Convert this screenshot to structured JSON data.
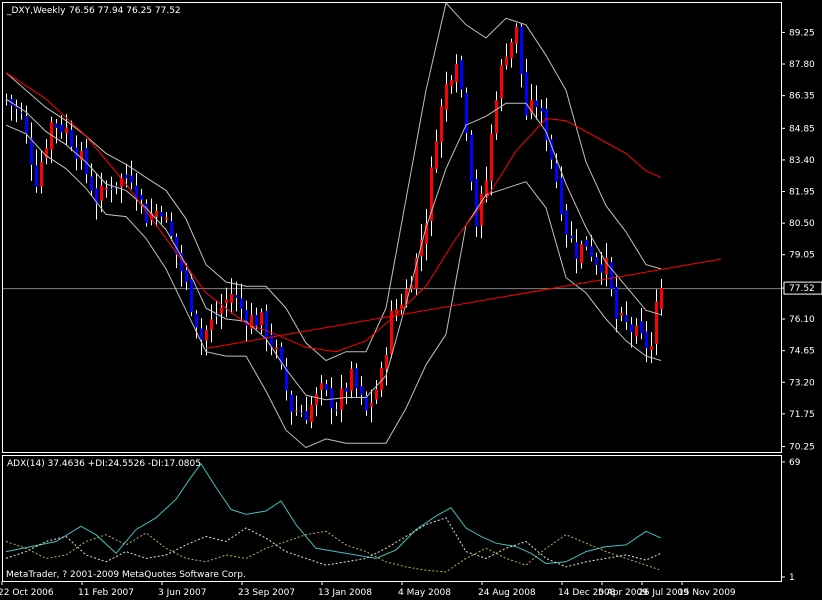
{
  "chart_data": {
    "type": "candlestick",
    "main_panel": {
      "symbol": "_DXY,Weekly",
      "ohlc": "76.56 77.94 76.25 77.52",
      "ylim": [
        70.0,
        90.6
      ],
      "y_ticks": [
        "89.25",
        "87.80",
        "86.35",
        "84.85",
        "83.40",
        "81.95",
        "80.50",
        "79.05",
        "77.52",
        "76.10",
        "74.65",
        "73.20",
        "71.75",
        "70.25"
      ],
      "current_price": 77.52,
      "colors": {
        "up": "#ff0000",
        "down": "#0000ff",
        "wick": "#ffffff",
        "bands": "#c0c0c0",
        "ma": "#ff0000",
        "trendline": "#ff0000",
        "price_line": "#808080"
      },
      "close_path": [
        [
          0,
          86.2
        ],
        [
          3,
          85.4
        ],
        [
          6,
          82.5
        ],
        [
          9,
          85.1
        ],
        [
          12,
          84.8
        ],
        [
          15,
          83.4
        ],
        [
          18,
          81.6
        ],
        [
          21,
          82.3
        ],
        [
          25,
          82.7
        ],
        [
          28,
          80.8
        ],
        [
          31,
          81.2
        ],
        [
          33,
          79.8
        ],
        [
          36,
          77.6
        ],
        [
          39,
          75.2
        ],
        [
          42,
          76.3
        ],
        [
          45,
          77.3
        ],
        [
          48,
          76.2
        ],
        [
          51,
          76.0
        ],
        [
          54,
          74.5
        ],
        [
          57,
          72.0
        ],
        [
          60,
          71.8
        ],
        [
          63,
          72.8
        ],
        [
          66,
          72.1
        ],
        [
          69,
          73.4
        ],
        [
          72,
          71.8
        ],
        [
          75,
          73.5
        ],
        [
          77,
          76.2
        ],
        [
          80,
          77.4
        ],
        [
          82,
          78.8
        ],
        [
          84,
          80.8
        ],
        [
          86,
          84.7
        ],
        [
          88,
          86.8
        ],
        [
          90,
          88.2
        ],
        [
          92,
          85.0
        ],
        [
          94,
          80.5
        ],
        [
          96,
          82.5
        ],
        [
          98,
          86.5
        ],
        [
          100,
          88.5
        ],
        [
          102,
          89.3
        ],
        [
          104,
          85.5
        ],
        [
          106,
          86.0
        ],
        [
          108,
          84.6
        ],
        [
          110,
          82.5
        ],
        [
          112,
          80.2
        ],
        [
          114,
          79.2
        ],
        [
          116,
          79.6
        ],
        [
          118,
          78.8
        ],
        [
          120,
          78.5
        ],
        [
          122,
          76.1
        ],
        [
          124,
          75.8
        ],
        [
          126,
          75.4
        ],
        [
          128,
          74.9
        ],
        [
          129,
          74.8
        ],
        [
          130,
          76.6
        ],
        [
          131,
          77.52
        ]
      ],
      "bollinger": {
        "middle": [
          [
            0,
            86.2
          ],
          [
            4,
            85.6
          ],
          [
            8,
            84.7
          ],
          [
            12,
            84.1
          ],
          [
            16,
            83.3
          ],
          [
            20,
            82.3
          ],
          [
            24,
            82.0
          ],
          [
            28,
            81.2
          ],
          [
            32,
            80.2
          ],
          [
            36,
            78.6
          ],
          [
            40,
            76.6
          ],
          [
            44,
            76.1
          ],
          [
            48,
            76.0
          ],
          [
            52,
            75.2
          ],
          [
            56,
            73.8
          ],
          [
            60,
            72.6
          ],
          [
            64,
            72.4
          ],
          [
            68,
            72.5
          ],
          [
            72,
            72.5
          ],
          [
            76,
            73.5
          ],
          [
            80,
            76.8
          ],
          [
            84,
            80.3
          ],
          [
            88,
            83.0
          ],
          [
            92,
            85.0
          ],
          [
            96,
            85.4
          ],
          [
            100,
            86.0
          ],
          [
            104,
            86.0
          ],
          [
            108,
            84.7
          ],
          [
            112,
            82.3
          ],
          [
            116,
            80.3
          ],
          [
            120,
            78.7
          ],
          [
            124,
            77.6
          ],
          [
            128,
            76.5
          ],
          [
            131,
            76.3
          ]
        ],
        "upper": [
          [
            0,
            87.4
          ],
          [
            4,
            86.6
          ],
          [
            8,
            85.8
          ],
          [
            12,
            85.2
          ],
          [
            16,
            84.5
          ],
          [
            20,
            83.7
          ],
          [
            24,
            83.2
          ],
          [
            28,
            82.6
          ],
          [
            32,
            82.0
          ],
          [
            36,
            80.7
          ],
          [
            40,
            78.6
          ],
          [
            44,
            77.8
          ],
          [
            48,
            77.6
          ],
          [
            52,
            77.6
          ],
          [
            56,
            76.6
          ],
          [
            60,
            75.0
          ],
          [
            64,
            74.2
          ],
          [
            68,
            74.6
          ],
          [
            72,
            74.6
          ],
          [
            76,
            76.6
          ],
          [
            80,
            81.6
          ],
          [
            84,
            86.6
          ],
          [
            88,
            90.6
          ],
          [
            92,
            89.6
          ],
          [
            96,
            89.0
          ],
          [
            100,
            89.9
          ],
          [
            104,
            89.6
          ],
          [
            108,
            88.2
          ],
          [
            112,
            86.6
          ],
          [
            116,
            83.3
          ],
          [
            120,
            81.3
          ],
          [
            124,
            80.1
          ],
          [
            128,
            78.6
          ],
          [
            131,
            78.4
          ]
        ],
        "lower": [
          [
            0,
            85.0
          ],
          [
            4,
            84.6
          ],
          [
            8,
            83.6
          ],
          [
            12,
            83.0
          ],
          [
            16,
            82.1
          ],
          [
            20,
            80.9
          ],
          [
            24,
            80.8
          ],
          [
            28,
            79.8
          ],
          [
            32,
            78.4
          ],
          [
            36,
            76.5
          ],
          [
            40,
            74.6
          ],
          [
            44,
            74.4
          ],
          [
            48,
            74.4
          ],
          [
            52,
            72.8
          ],
          [
            56,
            71.0
          ],
          [
            60,
            70.2
          ],
          [
            64,
            70.6
          ],
          [
            68,
            70.4
          ],
          [
            72,
            70.4
          ],
          [
            76,
            70.4
          ],
          [
            80,
            72.0
          ],
          [
            84,
            74.0
          ],
          [
            88,
            75.4
          ],
          [
            92,
            80.4
          ],
          [
            96,
            81.8
          ],
          [
            100,
            82.1
          ],
          [
            104,
            82.4
          ],
          [
            108,
            81.2
          ],
          [
            112,
            78.0
          ],
          [
            116,
            77.3
          ],
          [
            120,
            76.1
          ],
          [
            124,
            75.1
          ],
          [
            128,
            74.4
          ],
          [
            131,
            74.2
          ]
        ]
      },
      "moving_average": [
        [
          0,
          87.4
        ],
        [
          8,
          86.2
        ],
        [
          16,
          84.5
        ],
        [
          24,
          82.3
        ],
        [
          32,
          79.8
        ],
        [
          40,
          77.3
        ],
        [
          48,
          75.9
        ],
        [
          54,
          75.4
        ],
        [
          60,
          74.8
        ],
        [
          66,
          74.6
        ],
        [
          72,
          75.1
        ],
        [
          78,
          76.3
        ],
        [
          84,
          77.6
        ],
        [
          90,
          79.8
        ],
        [
          96,
          81.6
        ],
        [
          102,
          83.8
        ],
        [
          108,
          85.3
        ],
        [
          112,
          85.2
        ],
        [
          116,
          84.7
        ],
        [
          120,
          84.2
        ],
        [
          124,
          83.7
        ],
        [
          128,
          82.9
        ],
        [
          131,
          82.6
        ]
      ],
      "trendline": [
        [
          40,
          74.75
        ],
        [
          143,
          78.85
        ]
      ]
    },
    "indicator_panel": {
      "label": "ADX(14) 37.4636 +DI:24.5526 -DI:17.0805",
      "y_ticks": [
        "69",
        "1"
      ],
      "ylim": [
        1,
        69
      ],
      "colors": {
        "adx": "#40c0c0",
        "plus_di": "#e6e6c8",
        "minus_di": "#b4b450"
      },
      "adx": [
        [
          0,
          16
        ],
        [
          5,
          19
        ],
        [
          10,
          22
        ],
        [
          15,
          31
        ],
        [
          18,
          26
        ],
        [
          22,
          15
        ],
        [
          26,
          29
        ],
        [
          30,
          36
        ],
        [
          34,
          47
        ],
        [
          37,
          60
        ],
        [
          39,
          68
        ],
        [
          42,
          54
        ],
        [
          45,
          41
        ],
        [
          48,
          38
        ],
        [
          52,
          40
        ],
        [
          55,
          46
        ],
        [
          58,
          32
        ],
        [
          62,
          18
        ],
        [
          66,
          16
        ],
        [
          70,
          14
        ],
        [
          74,
          12
        ],
        [
          78,
          17
        ],
        [
          82,
          29
        ],
        [
          86,
          37
        ],
        [
          89,
          42
        ],
        [
          92,
          30
        ],
        [
          95,
          25
        ],
        [
          98,
          21
        ],
        [
          102,
          19
        ],
        [
          105,
          15
        ],
        [
          108,
          9
        ],
        [
          112,
          10
        ],
        [
          116,
          16
        ],
        [
          120,
          19
        ],
        [
          124,
          20
        ],
        [
          128,
          28
        ],
        [
          131,
          24
        ]
      ],
      "plus_di": [
        [
          0,
          12
        ],
        [
          4,
          16
        ],
        [
          8,
          22
        ],
        [
          12,
          25
        ],
        [
          16,
          14
        ],
        [
          20,
          10
        ],
        [
          24,
          16
        ],
        [
          28,
          12
        ],
        [
          32,
          14
        ],
        [
          36,
          20
        ],
        [
          40,
          25
        ],
        [
          44,
          22
        ],
        [
          48,
          30
        ],
        [
          52,
          24
        ],
        [
          56,
          16
        ],
        [
          60,
          12
        ],
        [
          64,
          8
        ],
        [
          68,
          10
        ],
        [
          72,
          12
        ],
        [
          76,
          18
        ],
        [
          80,
          25
        ],
        [
          84,
          32
        ],
        [
          88,
          36
        ],
        [
          92,
          16
        ],
        [
          96,
          12
        ],
        [
          100,
          18
        ],
        [
          104,
          22
        ],
        [
          108,
          12
        ],
        [
          112,
          7
        ],
        [
          116,
          10
        ],
        [
          120,
          12
        ],
        [
          124,
          14
        ],
        [
          128,
          11
        ],
        [
          131,
          15
        ]
      ],
      "minus_di": [
        [
          0,
          22
        ],
        [
          4,
          18
        ],
        [
          8,
          12
        ],
        [
          12,
          14
        ],
        [
          16,
          22
        ],
        [
          20,
          26
        ],
        [
          24,
          20
        ],
        [
          28,
          27
        ],
        [
          32,
          18
        ],
        [
          36,
          12
        ],
        [
          40,
          10
        ],
        [
          44,
          14
        ],
        [
          48,
          12
        ],
        [
          52,
          18
        ],
        [
          56,
          22
        ],
        [
          60,
          26
        ],
        [
          64,
          28
        ],
        [
          68,
          20
        ],
        [
          72,
          16
        ],
        [
          76,
          10
        ],
        [
          80,
          7
        ],
        [
          84,
          5
        ],
        [
          88,
          4
        ],
        [
          92,
          12
        ],
        [
          96,
          18
        ],
        [
          100,
          12
        ],
        [
          104,
          8
        ],
        [
          108,
          18
        ],
        [
          112,
          26
        ],
        [
          116,
          21
        ],
        [
          120,
          16
        ],
        [
          124,
          12
        ],
        [
          128,
          8
        ],
        [
          131,
          5
        ]
      ]
    },
    "x_tick_labels": [
      "22 Oct 2006",
      "11 Feb 2007",
      "3 Jun 2007",
      "23 Sep 2007",
      "13 Jan 2008",
      "4 May 2008",
      "24 Aug 2008",
      "14 Dec 2008",
      "5 Apr 2009",
      "26 Jul 2009",
      "15 Nov 2009"
    ],
    "x_tick_bars": [
      0,
      16,
      32,
      48,
      64,
      80,
      96,
      112,
      120,
      128,
      136
    ],
    "copyright": "MetaTrader, ? 2001-2009 MetaQuotes Software Corp."
  }
}
